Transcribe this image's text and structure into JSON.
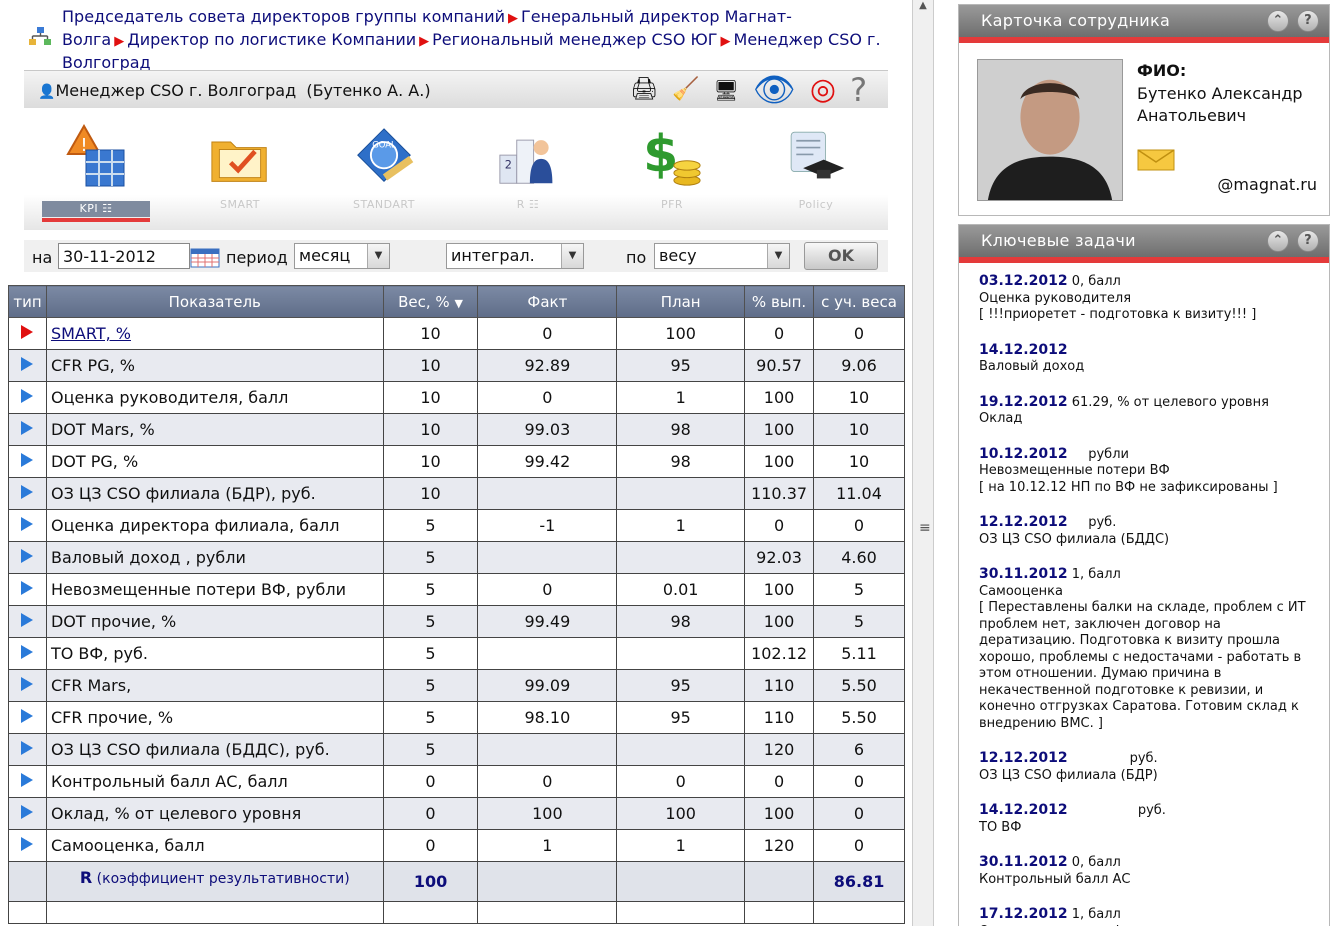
{
  "breadcrumb": {
    "items": [
      "Председатель совета директоров группы компаний",
      "Генеральный директор Магнат-Волга",
      "Директор по логистике Компании",
      "Региональный менеджер CSO ЮГ",
      "Менеджер CSO г. Волгоград"
    ]
  },
  "header": {
    "user": "Менеджер CSO г. Волгоград",
    "person": "(Бутенко А. А.)"
  },
  "modules": [
    {
      "label": "KPI",
      "suffix": "☷",
      "icon": "kpi-warning-grid-icon",
      "glyph": "⚠"
    },
    {
      "label": "SMART",
      "suffix": "",
      "icon": "folder-check-icon",
      "glyph": "📂"
    },
    {
      "label": "STANDART",
      "suffix": "",
      "icon": "goal-ruler-icon",
      "glyph": "🎯"
    },
    {
      "label": "R",
      "suffix": "☷",
      "icon": "podium-person-icon",
      "glyph": "🏆"
    },
    {
      "label": "PFR",
      "suffix": "",
      "icon": "dollar-coins-icon",
      "glyph": "💲"
    },
    {
      "label": "Policy",
      "suffix": "",
      "icon": "diploma-cap-icon",
      "glyph": "🎓"
    }
  ],
  "filters": {
    "na_label": "на",
    "date": "30-11-2012",
    "period_label": "период",
    "period": "месяц",
    "mode": "интеграл.",
    "po_label": "по",
    "by": "весу",
    "ok": "OK"
  },
  "table": {
    "headers": [
      "тип",
      "Показатель",
      "Вес, %",
      "Факт",
      "План",
      "% вып.",
      "с уч. веса"
    ],
    "rows": [
      {
        "type": "red",
        "name": "SMART, %",
        "link": true,
        "weight": "10",
        "fact": "0",
        "plan": "100",
        "pct": "0",
        "weighted": "0"
      },
      {
        "type": "blue",
        "name": "CFR PG, %",
        "link": false,
        "weight": "10",
        "fact": "92.89",
        "plan": "95",
        "pct": "90.57",
        "weighted": "9.06"
      },
      {
        "type": "blue",
        "name": "Оценка руководителя, балл",
        "link": false,
        "weight": "10",
        "fact": "0",
        "plan": "1",
        "pct": "100",
        "weighted": "10"
      },
      {
        "type": "blue",
        "name": "DOT Mars, %",
        "link": false,
        "weight": "10",
        "fact": "99.03",
        "plan": "98",
        "pct": "100",
        "weighted": "10"
      },
      {
        "type": "blue",
        "name": "DOT PG, %",
        "link": false,
        "weight": "10",
        "fact": "99.42",
        "plan": "98",
        "pct": "100",
        "weighted": "10"
      },
      {
        "type": "blue",
        "name": "ОЗ ЦЗ CSO филиала (БДР), руб.",
        "link": false,
        "weight": "10",
        "fact": "",
        "plan": "",
        "pct": "110.37",
        "weighted": "11.04"
      },
      {
        "type": "blue",
        "name": "Оценка директора филиала, балл",
        "link": false,
        "weight": "5",
        "fact": "-1",
        "plan": "1",
        "pct": "0",
        "weighted": "0"
      },
      {
        "type": "blue",
        "name": "Валовый доход , рубли",
        "link": false,
        "weight": "5",
        "fact": "",
        "plan": "",
        "pct": "92.03",
        "weighted": "4.60"
      },
      {
        "type": "blue",
        "name": "Невозмещенные потери ВФ, рубли",
        "link": false,
        "weight": "5",
        "fact": "0",
        "plan": "0.01",
        "pct": "100",
        "weighted": "5"
      },
      {
        "type": "blue",
        "name": "DOT прочие, %",
        "link": false,
        "weight": "5",
        "fact": "99.49",
        "plan": "98",
        "pct": "100",
        "weighted": "5"
      },
      {
        "type": "blue",
        "name": "ТО ВФ, руб.",
        "link": false,
        "weight": "5",
        "fact": "",
        "plan": "",
        "pct": "102.12",
        "weighted": "5.11"
      },
      {
        "type": "blue",
        "name": "CFR Mars,",
        "link": false,
        "weight": "5",
        "fact": "99.09",
        "plan": "95",
        "pct": "110",
        "weighted": "5.50"
      },
      {
        "type": "blue",
        "name": "CFR прочие, %",
        "link": false,
        "weight": "5",
        "fact": "98.10",
        "plan": "95",
        "pct": "110",
        "weighted": "5.50"
      },
      {
        "type": "blue",
        "name": "ОЗ ЦЗ CSO филиала (БДДС), руб.",
        "link": false,
        "weight": "5",
        "fact": "",
        "plan": "",
        "pct": "120",
        "weighted": "6"
      },
      {
        "type": "blue",
        "name": "Контрольный балл АС, балл",
        "link": false,
        "weight": "0",
        "fact": "0",
        "plan": "0",
        "pct": "0",
        "weighted": "0"
      },
      {
        "type": "blue",
        "name": "Оклад, % от целевого уровня",
        "link": false,
        "weight": "0",
        "fact": "100",
        "plan": "100",
        "pct": "100",
        "weighted": "0"
      },
      {
        "type": "blue",
        "name": "Самооценка, балл",
        "link": false,
        "weight": "0",
        "fact": "1",
        "plan": "1",
        "pct": "120",
        "weighted": "0"
      }
    ],
    "total_label_bold": "R",
    "total_label": "(коэффициент результативности)",
    "total_weight": "100",
    "total_weighted": "86.81"
  },
  "card": {
    "title": "Карточка сотрудника",
    "fio_label": "ФИО:",
    "fio": "Бутенко Александр Анатольевич",
    "email": "@magnat.ru"
  },
  "tasks_panel": {
    "title": "Ключевые задачи",
    "items": [
      {
        "date": "03.12.2012",
        "meta": " 0, балл",
        "title": "Оценка руководителя",
        "note": "[ !!!приоретет - подготовка к визиту!!! ]"
      },
      {
        "date": "14.12.2012",
        "meta": "",
        "title": "Валовый доход",
        "note": ""
      },
      {
        "date": "19.12.2012",
        "meta": " 61.29, % от целевого уровня",
        "title": "Оклад",
        "note": ""
      },
      {
        "date": "10.12.2012",
        "meta": "     рубли",
        "title": "Невозмещенные потери ВФ",
        "note": "[ на 10.12.12 НП по ВФ не зафиксированы ]"
      },
      {
        "date": "12.12.2012",
        "meta": "     руб.",
        "title": "ОЗ ЦЗ CSO филиала (БДДС)",
        "note": ""
      },
      {
        "date": "30.11.2012",
        "meta": " 1, балл",
        "title": "Самооценка",
        "note": "[ Переставлены балки на складе, проблем с ИТ проблем нет, заключен договор на дератизацию. Подготовка к визиту прошла хорошо, проблемы с недостачами - работать в этом отношении. Думаю причина в некачественной подготовке к ревизии, и конечно отгрузках Саратова. Готовим склад к внедрению ВМС. ]"
      },
      {
        "date": "12.12.2012",
        "meta": "               руб.",
        "title": "ОЗ ЦЗ CSO филиала (БДР)",
        "note": ""
      },
      {
        "date": "14.12.2012",
        "meta": "                 руб.",
        "title": "ТО ВФ",
        "note": ""
      },
      {
        "date": "30.11.2012",
        "meta": " 0, балл",
        "title": "Контрольный балл АС",
        "note": ""
      },
      {
        "date": "17.12.2012",
        "meta": " 1, балл",
        "title": "Оценка директора филиала",
        "note": ""
      }
    ]
  }
}
